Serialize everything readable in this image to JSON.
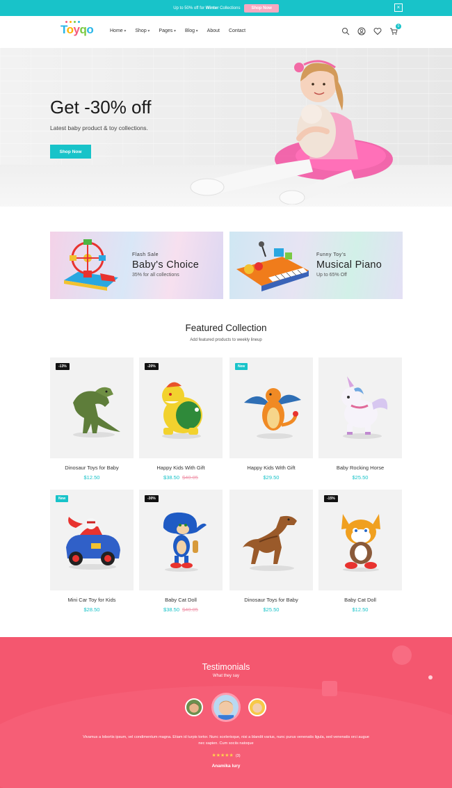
{
  "promo_bar": {
    "text_before": "Up to 50% off for",
    "highlight": "Winter",
    "text_after": "Collections",
    "button": "Shop Now",
    "close": "×"
  },
  "header": {
    "logo": [
      "T",
      "o",
      "y",
      "q",
      "o"
    ],
    "nav": [
      {
        "label": "Home",
        "dropdown": true
      },
      {
        "label": "Shop",
        "dropdown": true
      },
      {
        "label": "Pages",
        "dropdown": true
      },
      {
        "label": "Blog",
        "dropdown": true
      },
      {
        "label": "About",
        "dropdown": false
      },
      {
        "label": "Contact",
        "dropdown": false
      }
    ],
    "icons": [
      "search-icon",
      "user-icon",
      "heart-icon",
      "cart-icon"
    ],
    "cart_count": "0"
  },
  "hero": {
    "title": "Get -30% off",
    "subtitle": "Latest baby product & toy collections.",
    "button": "Shop Now"
  },
  "banners": [
    {
      "small": "Flash Sale",
      "big": "Baby's Choice",
      "sub": "35% for all collections"
    },
    {
      "small": "Funny Toy's",
      "big": "Musical Piano",
      "sub": "Up to 65% Off"
    }
  ],
  "featured": {
    "title": "Featured Collection",
    "subtitle": "Add featured products to weekly lineup",
    "products": [
      {
        "name": "Dinosaur Toys for Baby",
        "price": "$12.50",
        "old_price": "",
        "badge": "-13%",
        "badge_style": "dark",
        "toy": "dinosaur-green"
      },
      {
        "name": "Happy Kids With Gift",
        "price": "$38.50",
        "old_price": "$40.85",
        "badge": "-20%",
        "badge_style": "dark",
        "toy": "bowser"
      },
      {
        "name": "Happy Kids With Gift",
        "price": "$29.50",
        "old_price": "",
        "badge": "New",
        "badge_style": "teal",
        "toy": "charizard"
      },
      {
        "name": "Baby Rocking Horse",
        "price": "$25.50",
        "old_price": "",
        "badge": "",
        "badge_style": "",
        "toy": "unicorn"
      },
      {
        "name": "Mini Car Toy for Kids",
        "price": "$28.50",
        "old_price": "",
        "badge": "New",
        "badge_style": "teal",
        "toy": "car"
      },
      {
        "name": "Baby Cat Doll",
        "price": "$38.50",
        "old_price": "$40.85",
        "badge": "-30%",
        "badge_style": "dark",
        "toy": "sonic"
      },
      {
        "name": "Dinosaur Toys for Baby",
        "price": "$25.50",
        "old_price": "",
        "badge": "",
        "badge_style": "",
        "toy": "trex-brown"
      },
      {
        "name": "Baby Cat Doll",
        "price": "$12.50",
        "old_price": "",
        "badge": "-15%",
        "badge_style": "dark",
        "toy": "tails"
      }
    ]
  },
  "testimonials": {
    "title": "Testimonials",
    "subtitle": "What they say",
    "quote": "Vivamus a lobortis ipsum, vel condimentum magna. Etiam id turpis tortor. Nunc scelerisque, nisi a blandit varius, nunc purus venenatis ligula, sed venenatis orci augue nec sapien. Cum sociis natoque",
    "stars": "★★★★★",
    "rating_count": "(3)",
    "author": "Anamika lury"
  },
  "colors": {
    "accent": "#18c3c9",
    "pink": "#f4576f",
    "old_price": "#f19aae"
  }
}
